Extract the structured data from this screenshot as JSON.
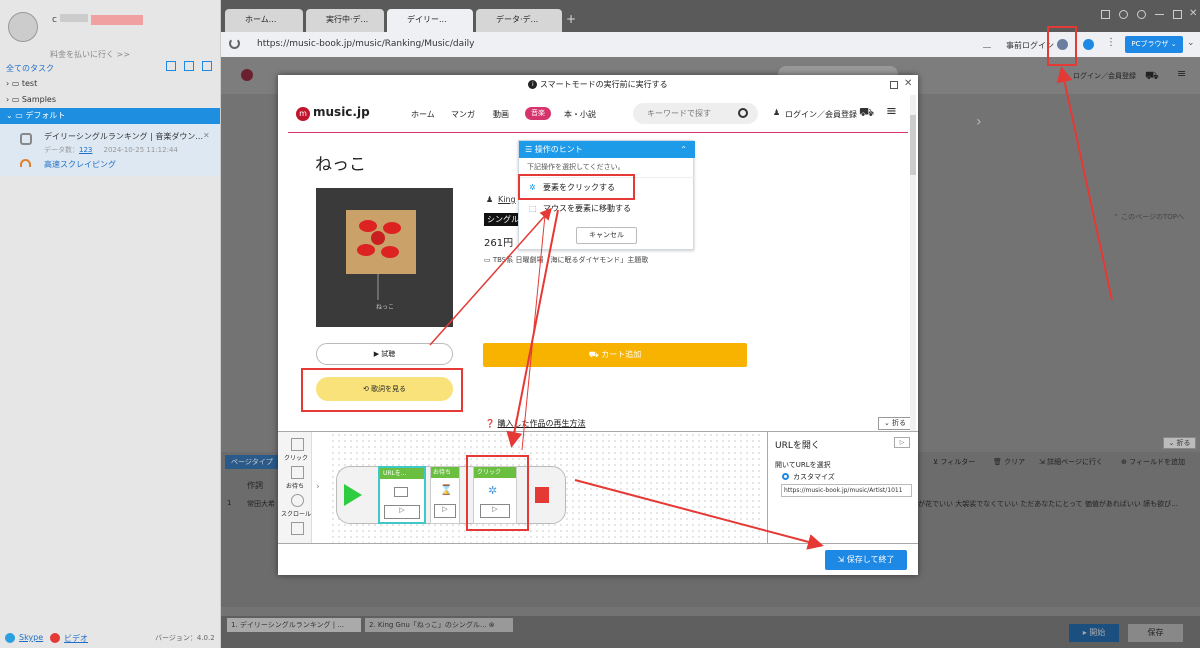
{
  "sidebar": {
    "username_prefix": "c",
    "upgrade_text": "料金を払いに行く >>",
    "all_tasks_label": "全てのタスク",
    "folders": [
      "test",
      "Samples",
      "デフォルト"
    ],
    "task": {
      "title": "デイリーシングルランキング | 音楽ダウン...",
      "data_count_label": "データ数：",
      "data_count": "123",
      "timestamp": "2024-10-25 11:12:44",
      "mode_label": "高速スクレイピング"
    },
    "skype_label": "Skype",
    "video_label": "ビデオ",
    "version": "バージョン：4.0.2"
  },
  "browser": {
    "tabs": [
      "ホーム...",
      "実行中·デ...",
      "デイリー...",
      "データ·デ..."
    ],
    "new_tab_symbol": "+",
    "url": "https://music-book.jp/music/Ranking/Music/daily",
    "prelogin_label": "事前ログイン",
    "pc_browser_label": "PCブラウザ",
    "page_login_label": "ログイン／会員登録",
    "page_to_top_label": "このページのTOPへ",
    "page_fold_label": "折る"
  },
  "data_panel": {
    "tab_label": "ページタイプ",
    "column_header": "作詞",
    "row_index": "1",
    "row_lyricist": "常田大希",
    "row_overflow_text": "が花でいい 大袈裟でなくていい ただあなたにとって 価値があればいい 諦も欲ぴ...",
    "toolbar": {
      "filter": "フィルター",
      "clear": "クリア",
      "detail": "詳細ページに行く",
      "add_field": "フィールドを追加"
    }
  },
  "footer": {
    "tabs": [
      "1. デイリーシングルランキング | ...",
      "2. King Gnu「ねっこ」のシングル..."
    ],
    "start_label": "開始",
    "save_label": "保存"
  },
  "modal": {
    "title": "スマートモードの実行前に実行する",
    "site": {
      "logo": "music.jp",
      "nav": [
        "ホーム",
        "マンガ",
        "動画",
        "音楽",
        "本・小説"
      ],
      "search_placeholder": "キーワードで探す",
      "login": "ログイン／会員登録"
    },
    "song": {
      "title": "ねっこ",
      "artist": "King",
      "single_badge": "シングル",
      "price": "261円",
      "tieup": "TBS系 日曜劇場「海に眠るダイヤモンド」主題歌",
      "trial_label": "試聴",
      "lyrics_label": "歌詞を見る",
      "cart_label": "カート追加",
      "howto_label": "購入した作品の再生方法",
      "fold_label": "折る",
      "jacket_caption": "ねっこ"
    },
    "hint": {
      "title": "操作のヒント",
      "instruction": "下記操作を選択してください。",
      "option_click": "要素をクリックする",
      "option_hover": "マウスを要素に移動する",
      "cancel": "キャンセル"
    },
    "palette": {
      "items": [
        "クリック",
        "お待ち",
        "スクロール"
      ]
    },
    "flow": {
      "nodes": [
        "URLを...",
        "お待ち",
        "クリック"
      ]
    },
    "url_panel": {
      "title": "URLを開く",
      "select_label": "開いてURLを選択",
      "custom_label": "カスタマイズ",
      "url_value": "https://music-book.jp/music/Artist/1011"
    },
    "save_end_label": "保存して終了"
  },
  "colors": {
    "accent_blue": "#1e88e5",
    "annotation_red": "#e53935",
    "lyrics_yellow": "#f9e27a",
    "cart_orange": "#f7b300",
    "music_pink": "#d6336c"
  }
}
